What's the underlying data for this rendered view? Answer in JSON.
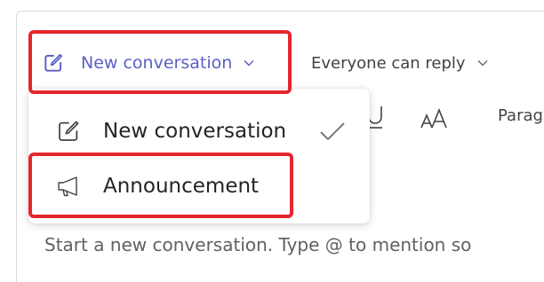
{
  "composer": {
    "type_selector": {
      "label": "New conversation",
      "icon": "compose-icon",
      "chevron": "chevron-down-icon"
    },
    "reply_setting": {
      "label": "Everyone can reply",
      "chevron": "chevron-down-icon"
    },
    "formatting_toolbar": {
      "visible_items": [
        "underline-icon",
        "font-size-icon"
      ],
      "paragraph_label": "Parag"
    },
    "placeholder": "Start a new conversation. Type @ to mention so"
  },
  "post_type_menu": {
    "items": [
      {
        "label": "New conversation",
        "icon": "compose-icon",
        "selected": true
      },
      {
        "label": "Announcement",
        "icon": "megaphone-icon",
        "selected": false
      }
    ]
  },
  "annotations": {
    "highlight_color": "#e4262d"
  },
  "colors": {
    "accent": "#5b5fc7",
    "text": "#242424"
  }
}
